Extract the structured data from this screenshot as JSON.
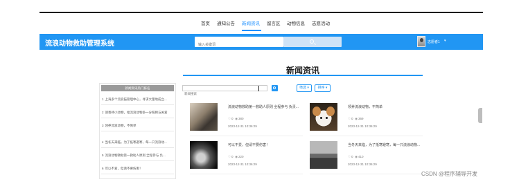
{
  "nav": {
    "items": [
      {
        "label": "首页",
        "active": false
      },
      {
        "label": "通知公告",
        "active": false
      },
      {
        "label": "新闻资讯",
        "active": true
      },
      {
        "label": "留言区",
        "active": false
      },
      {
        "label": "动物信息",
        "active": false
      },
      {
        "label": "志愿活动",
        "active": false
      }
    ]
  },
  "header": {
    "title": "流浪动物救助管理系统",
    "search_placeholder": "输入关键词",
    "user_name": "志愿者1",
    "caret": "▾"
  },
  "section": {
    "title": "新闻资讯"
  },
  "sidebar": {
    "title": "新闻资讯热门排名",
    "items": [
      {
        "idx": "1",
        "text": "上海多个流浪猫管理中心，寻求大量地成立..."
      },
      {
        "idx": "2",
        "text": "请善待小动物，给流浪动物多一分照顾与关爱"
      },
      {
        "idx": "3",
        "text": "领养流浪动物，不简单"
      },
      {
        "idx": "4",
        "text": "当冬天来临，为了抵寒避寒，每一只流浪动..."
      },
      {
        "idx": "5",
        "text": "流浪动物救助第一救助人原则 全程参与 负..."
      },
      {
        "idx": "6",
        "text": "可以不爱，但请不要伤害！"
      }
    ]
  },
  "filter": {
    "placeholder": "新闻搜索",
    "sort_label": "筛选 ▾",
    "order_label": "排序 ▾"
  },
  "news": [
    {
      "title": "流浪动物救助第一救助人原则 全程参与 负责...",
      "likes": "0",
      "views": "380",
      "date": "2023-12-31 10:36:29",
      "thumb": "cats"
    },
    {
      "title": "领养流浪动物，不简单",
      "likes": "0",
      "views": "369",
      "date": "2023-12-31 10:36:29",
      "thumb": "dog"
    },
    {
      "title": "可以不爱，但请不要伤害！",
      "likes": "0",
      "views": "220",
      "date": "2023-12-31 10:36:29",
      "thumb": "bw1"
    },
    {
      "title": "当冬天来临，为了抵寒避寒，每一只流浪动物...",
      "likes": "0",
      "views": "410",
      "date": "2023-12-31 10:36:29",
      "thumb": "bw2"
    }
  ],
  "icons": {
    "like": "like-icon",
    "view": "eye-icon",
    "search": "search-icon"
  },
  "colors": {
    "accent": "#2196f3",
    "nav_active": "#1e90ff"
  },
  "watermark": "CSDN @程序辅导开发"
}
